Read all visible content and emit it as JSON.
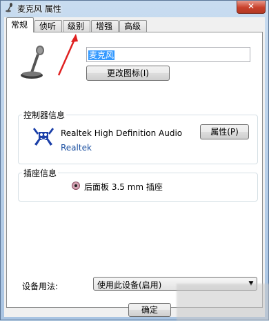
{
  "window": {
    "title": "麦克风 属性",
    "close_label": "✕",
    "icons": {
      "title": "microphone-icon",
      "close": "close-icon"
    }
  },
  "tabs": [
    {
      "label": "常规",
      "active": true
    },
    {
      "label": "侦听",
      "active": false
    },
    {
      "label": "级别",
      "active": false
    },
    {
      "label": "增强",
      "active": false
    },
    {
      "label": "高级",
      "active": false
    }
  ],
  "general": {
    "device_name": "麦克风",
    "change_icon_button": "更改图标(I)",
    "controller": {
      "group_label": "控制器信息",
      "name": "Realtek High Definition Audio",
      "vendor": "Realtek",
      "properties_button": "属性(P)",
      "icon": "realtek-crab-logo-icon"
    },
    "jack": {
      "group_label": "插座信息",
      "description": "后面板 3.5 mm 插座",
      "color": "#d3a3b3"
    },
    "device_usage": {
      "label": "设备用法:",
      "value": "使用此设备(启用)"
    }
  },
  "footer": {
    "ok_button": "确定"
  },
  "colors": {
    "titlebar": "#c8dcf0",
    "selection": "#3399ff",
    "annotation_arrow": "#e02020",
    "link": "#1a4fa0"
  }
}
